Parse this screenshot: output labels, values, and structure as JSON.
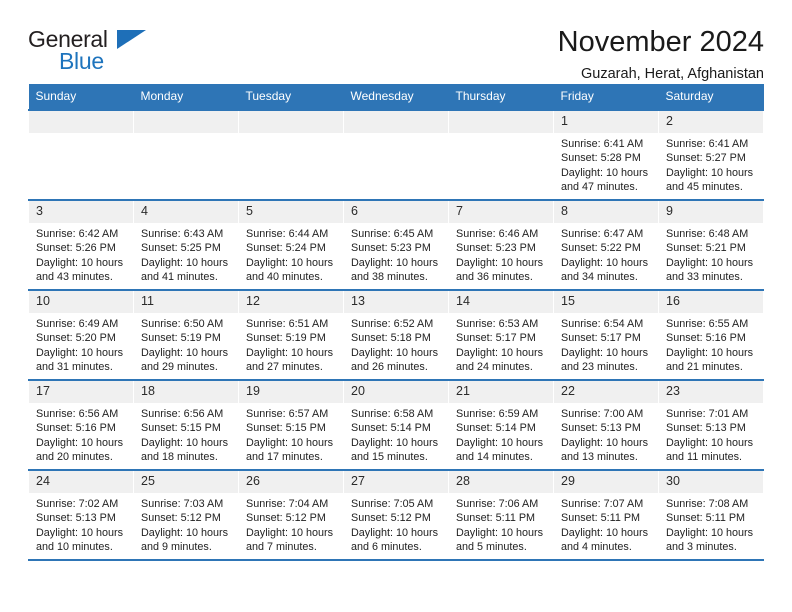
{
  "brand": {
    "name_top": "General",
    "name_bottom": "Blue",
    "accent_color": "#2e75b6",
    "logo_blue": "#1e74bd"
  },
  "header": {
    "title": "November 2024",
    "subtitle": "Guzarah, Herat, Afghanistan"
  },
  "calendar": {
    "weekday_headers": [
      "Sunday",
      "Monday",
      "Tuesday",
      "Wednesday",
      "Thursday",
      "Friday",
      "Saturday"
    ],
    "labels": {
      "sunrise": "Sunrise:",
      "sunset": "Sunset:",
      "daylight": "Daylight:"
    },
    "weeks": [
      [
        {
          "day": ""
        },
        {
          "day": ""
        },
        {
          "day": ""
        },
        {
          "day": ""
        },
        {
          "day": ""
        },
        {
          "day": "1",
          "sunrise": "Sunrise: 6:41 AM",
          "sunset": "Sunset: 5:28 PM",
          "daylight": "Daylight: 10 hours and 47 minutes."
        },
        {
          "day": "2",
          "sunrise": "Sunrise: 6:41 AM",
          "sunset": "Sunset: 5:27 PM",
          "daylight": "Daylight: 10 hours and 45 minutes."
        }
      ],
      [
        {
          "day": "3",
          "sunrise": "Sunrise: 6:42 AM",
          "sunset": "Sunset: 5:26 PM",
          "daylight": "Daylight: 10 hours and 43 minutes."
        },
        {
          "day": "4",
          "sunrise": "Sunrise: 6:43 AM",
          "sunset": "Sunset: 5:25 PM",
          "daylight": "Daylight: 10 hours and 41 minutes."
        },
        {
          "day": "5",
          "sunrise": "Sunrise: 6:44 AM",
          "sunset": "Sunset: 5:24 PM",
          "daylight": "Daylight: 10 hours and 40 minutes."
        },
        {
          "day": "6",
          "sunrise": "Sunrise: 6:45 AM",
          "sunset": "Sunset: 5:23 PM",
          "daylight": "Daylight: 10 hours and 38 minutes."
        },
        {
          "day": "7",
          "sunrise": "Sunrise: 6:46 AM",
          "sunset": "Sunset: 5:23 PM",
          "daylight": "Daylight: 10 hours and 36 minutes."
        },
        {
          "day": "8",
          "sunrise": "Sunrise: 6:47 AM",
          "sunset": "Sunset: 5:22 PM",
          "daylight": "Daylight: 10 hours and 34 minutes."
        },
        {
          "day": "9",
          "sunrise": "Sunrise: 6:48 AM",
          "sunset": "Sunset: 5:21 PM",
          "daylight": "Daylight: 10 hours and 33 minutes."
        }
      ],
      [
        {
          "day": "10",
          "sunrise": "Sunrise: 6:49 AM",
          "sunset": "Sunset: 5:20 PM",
          "daylight": "Daylight: 10 hours and 31 minutes."
        },
        {
          "day": "11",
          "sunrise": "Sunrise: 6:50 AM",
          "sunset": "Sunset: 5:19 PM",
          "daylight": "Daylight: 10 hours and 29 minutes."
        },
        {
          "day": "12",
          "sunrise": "Sunrise: 6:51 AM",
          "sunset": "Sunset: 5:19 PM",
          "daylight": "Daylight: 10 hours and 27 minutes."
        },
        {
          "day": "13",
          "sunrise": "Sunrise: 6:52 AM",
          "sunset": "Sunset: 5:18 PM",
          "daylight": "Daylight: 10 hours and 26 minutes."
        },
        {
          "day": "14",
          "sunrise": "Sunrise: 6:53 AM",
          "sunset": "Sunset: 5:17 PM",
          "daylight": "Daylight: 10 hours and 24 minutes."
        },
        {
          "day": "15",
          "sunrise": "Sunrise: 6:54 AM",
          "sunset": "Sunset: 5:17 PM",
          "daylight": "Daylight: 10 hours and 23 minutes."
        },
        {
          "day": "16",
          "sunrise": "Sunrise: 6:55 AM",
          "sunset": "Sunset: 5:16 PM",
          "daylight": "Daylight: 10 hours and 21 minutes."
        }
      ],
      [
        {
          "day": "17",
          "sunrise": "Sunrise: 6:56 AM",
          "sunset": "Sunset: 5:16 PM",
          "daylight": "Daylight: 10 hours and 20 minutes."
        },
        {
          "day": "18",
          "sunrise": "Sunrise: 6:56 AM",
          "sunset": "Sunset: 5:15 PM",
          "daylight": "Daylight: 10 hours and 18 minutes."
        },
        {
          "day": "19",
          "sunrise": "Sunrise: 6:57 AM",
          "sunset": "Sunset: 5:15 PM",
          "daylight": "Daylight: 10 hours and 17 minutes."
        },
        {
          "day": "20",
          "sunrise": "Sunrise: 6:58 AM",
          "sunset": "Sunset: 5:14 PM",
          "daylight": "Daylight: 10 hours and 15 minutes."
        },
        {
          "day": "21",
          "sunrise": "Sunrise: 6:59 AM",
          "sunset": "Sunset: 5:14 PM",
          "daylight": "Daylight: 10 hours and 14 minutes."
        },
        {
          "day": "22",
          "sunrise": "Sunrise: 7:00 AM",
          "sunset": "Sunset: 5:13 PM",
          "daylight": "Daylight: 10 hours and 13 minutes."
        },
        {
          "day": "23",
          "sunrise": "Sunrise: 7:01 AM",
          "sunset": "Sunset: 5:13 PM",
          "daylight": "Daylight: 10 hours and 11 minutes."
        }
      ],
      [
        {
          "day": "24",
          "sunrise": "Sunrise: 7:02 AM",
          "sunset": "Sunset: 5:13 PM",
          "daylight": "Daylight: 10 hours and 10 minutes."
        },
        {
          "day": "25",
          "sunrise": "Sunrise: 7:03 AM",
          "sunset": "Sunset: 5:12 PM",
          "daylight": "Daylight: 10 hours and 9 minutes."
        },
        {
          "day": "26",
          "sunrise": "Sunrise: 7:04 AM",
          "sunset": "Sunset: 5:12 PM",
          "daylight": "Daylight: 10 hours and 7 minutes."
        },
        {
          "day": "27",
          "sunrise": "Sunrise: 7:05 AM",
          "sunset": "Sunset: 5:12 PM",
          "daylight": "Daylight: 10 hours and 6 minutes."
        },
        {
          "day": "28",
          "sunrise": "Sunrise: 7:06 AM",
          "sunset": "Sunset: 5:11 PM",
          "daylight": "Daylight: 10 hours and 5 minutes."
        },
        {
          "day": "29",
          "sunrise": "Sunrise: 7:07 AM",
          "sunset": "Sunset: 5:11 PM",
          "daylight": "Daylight: 10 hours and 4 minutes."
        },
        {
          "day": "30",
          "sunrise": "Sunrise: 7:08 AM",
          "sunset": "Sunset: 5:11 PM",
          "daylight": "Daylight: 10 hours and 3 minutes."
        }
      ]
    ]
  }
}
